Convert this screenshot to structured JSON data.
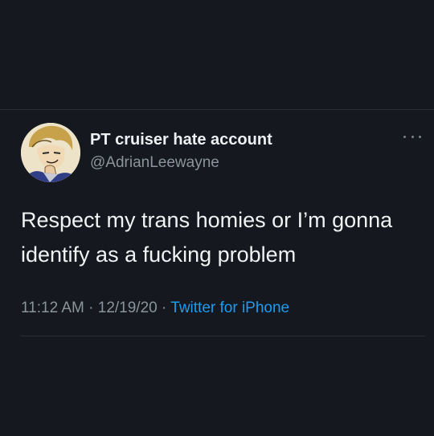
{
  "tweet": {
    "display_name": "PT cruiser hate account",
    "handle": "@AdrianLeewayne",
    "text": "Respect my trans homies or I’m gonna identify as a fucking problem",
    "time": "11:12 AM",
    "separator": "·",
    "date": "12/19/20",
    "source": "Twitter for iPhone"
  },
  "icons": {
    "more": "more-horizontal-icon",
    "avatar": "user-avatar"
  },
  "colors": {
    "background": "#15181e",
    "text": "#f0f2f4",
    "muted": "#8a949d",
    "link": "#1d9bf0"
  }
}
